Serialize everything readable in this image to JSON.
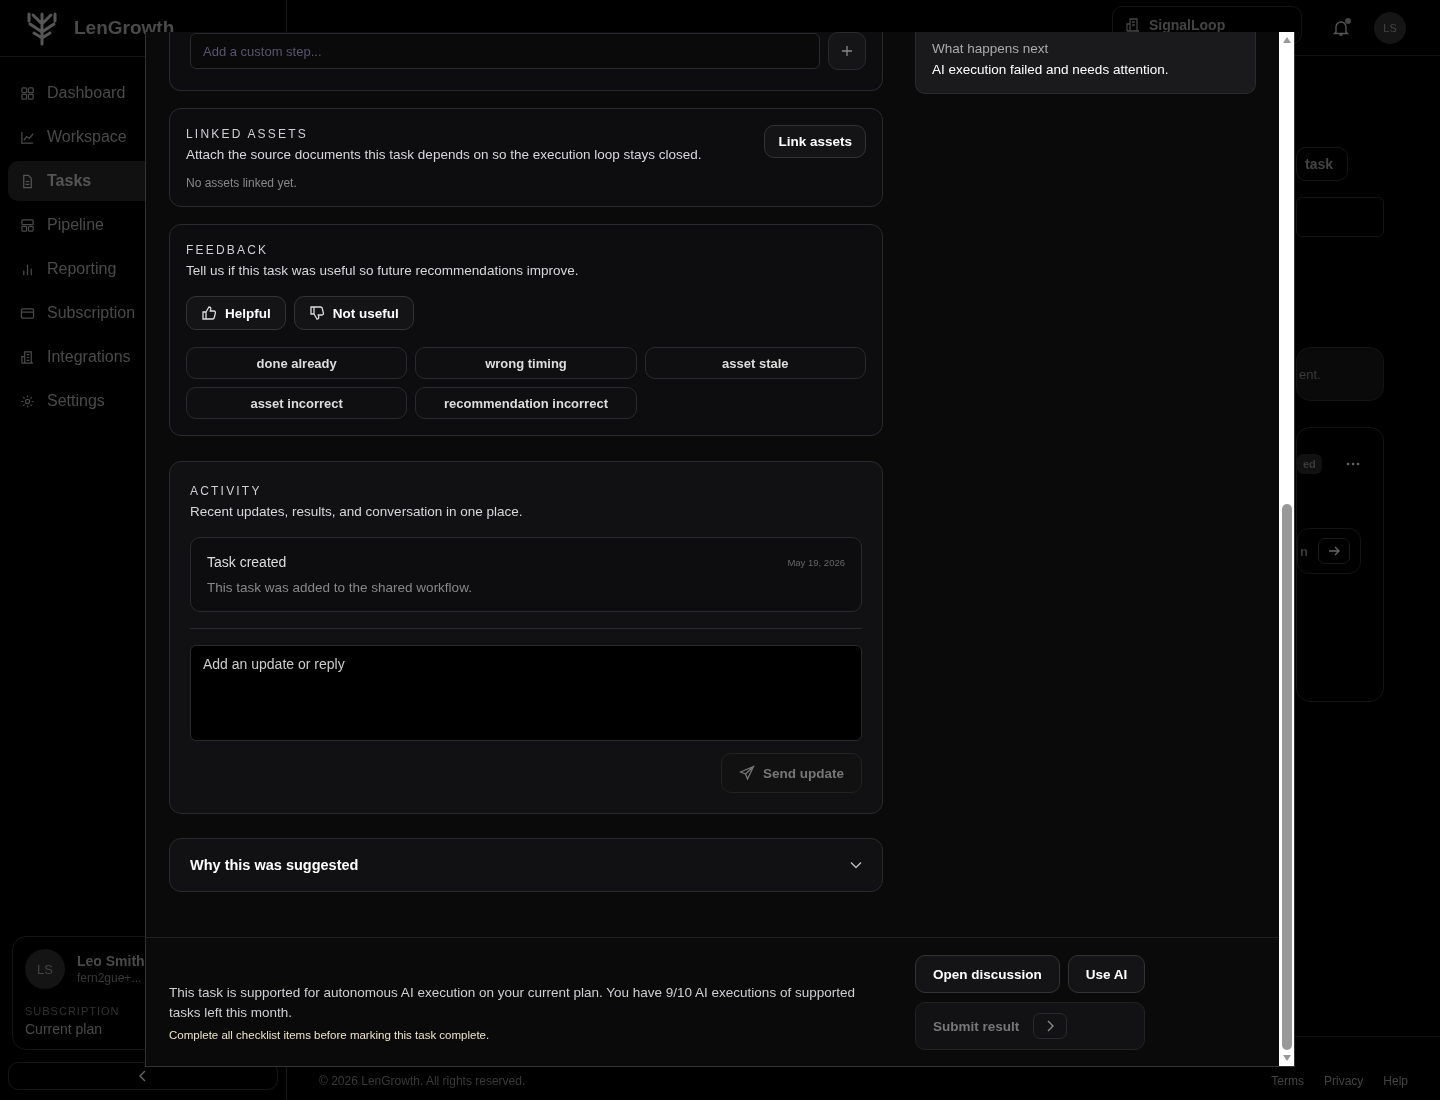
{
  "app": {
    "logo": "LenGrowth",
    "nav": [
      {
        "label": "Dashboard",
        "kind": "grid",
        "selected": false
      },
      {
        "label": "Workspace",
        "kind": "chart",
        "selected": false
      },
      {
        "label": "Tasks",
        "kind": "doc",
        "selected": true
      },
      {
        "label": "Pipeline",
        "kind": "layout",
        "selected": false
      },
      {
        "label": "Reporting",
        "kind": "bars",
        "selected": false
      },
      {
        "label": "Subscription",
        "kind": "card",
        "selected": false
      },
      {
        "label": "Integrations",
        "kind": "building",
        "selected": false
      },
      {
        "label": "Settings",
        "kind": "gear",
        "selected": false
      }
    ],
    "user": {
      "initials": "LS",
      "name": "Leo Smith",
      "email": "fern2gue+...",
      "plan_label": "SUBSCRIPTION",
      "plan": "Current plan"
    },
    "workspace": "SignalLoop",
    "avatar": "LS",
    "notifications": true,
    "fragments": {
      "button": "task",
      "notice": "ent.",
      "badge": "ed",
      "action": "n"
    },
    "footer": {
      "copyright": "© 2026 LenGrowth. All rights reserved.",
      "links": [
        "Terms",
        "Privacy",
        "Help"
      ]
    }
  },
  "modal": {
    "checklist": {
      "placeholder": "Add a custom step..."
    },
    "linked_assets": {
      "heading": "LINKED ASSETS",
      "description": "Attach the source documents this task depends on so the execution loop stays closed.",
      "button": "Link assets",
      "empty": "No assets linked yet."
    },
    "feedback": {
      "heading": "FEEDBACK",
      "description": "Tell us if this task was useful so future recommendations improve.",
      "votes": [
        {
          "label": "Helpful",
          "kind": "up"
        },
        {
          "label": "Not useful",
          "kind": "down"
        }
      ],
      "reasons": [
        "done already",
        "wrong timing",
        "asset stale",
        "asset incorrect",
        "recommendation incorrect"
      ]
    },
    "activity": {
      "heading": "ACTIVITY",
      "description": "Recent updates, results, and conversation in one place.",
      "entries": [
        {
          "title": "Task created",
          "date": "May 19, 2026",
          "body": "This task was added to the shared workflow."
        }
      ],
      "reply_placeholder": "Add an update or reply",
      "send": {
        "label": "Send update",
        "disabled": true
      }
    },
    "why": {
      "title": "Why this was suggested",
      "expanded": false
    },
    "next": {
      "label": "What happens next",
      "text": "AI execution failed and needs attention."
    },
    "footer": {
      "notice": "This task is supported for autonomous AI execution on your current plan. You have 9/10 AI executions of supported tasks left this month.",
      "warning": "Complete all checklist items before marking this task complete.",
      "buttons": [
        "Open discussion",
        "Use AI"
      ],
      "submit": {
        "label": "Submit result",
        "disabled": true
      }
    }
  }
}
